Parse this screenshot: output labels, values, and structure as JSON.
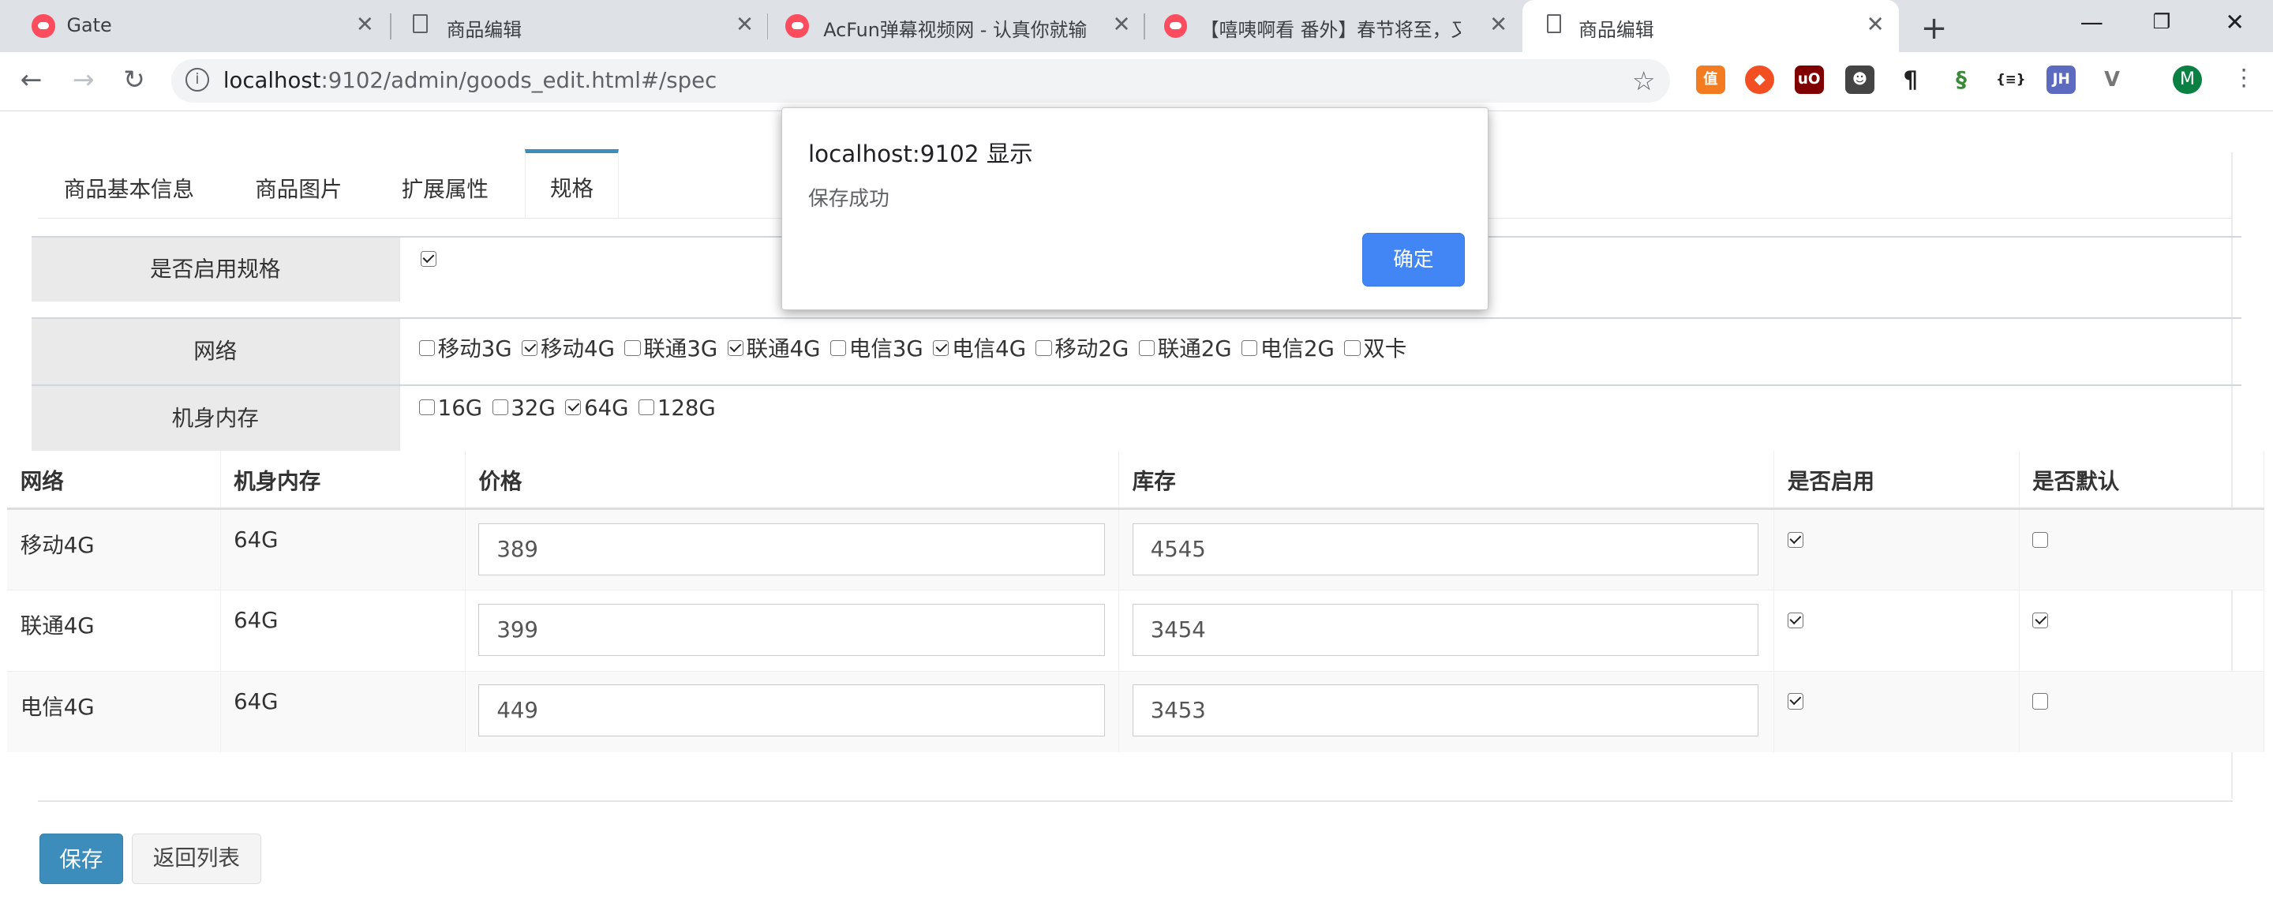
{
  "browser": {
    "tabs": [
      {
        "title": "Gate",
        "icon": "acfun-favicon-icon",
        "active": false
      },
      {
        "title": "商品编辑",
        "icon": "document-icon",
        "active": false
      },
      {
        "title": "AcFun弹幕视频网 - 认真你就输啦",
        "icon": "acfun-favicon-icon",
        "active": false
      },
      {
        "title": "【嘻咦啊看 番外】春节将至，又是",
        "icon": "acfun-favicon-icon",
        "active": false
      },
      {
        "title": "商品编辑",
        "icon": "document-icon",
        "active": true
      }
    ],
    "url_host": "localhost",
    "url_path": ":9102/admin/goods_edit.html#/spec",
    "profile_initial": "M",
    "extensions": [
      "值",
      "◆",
      "uO",
      "☻",
      "¶",
      "§",
      "{≡}",
      "JH",
      "V"
    ]
  },
  "page": {
    "tabs": [
      "商品基本信息",
      "商品图片",
      "扩展属性",
      "规格"
    ],
    "active_tab": "规格",
    "enable_spec_label": "是否启用规格",
    "enable_spec_checked": true,
    "spec_groups": [
      {
        "label": "网络",
        "options": [
          {
            "name": "移动3G",
            "checked": false
          },
          {
            "name": "移动4G",
            "checked": true
          },
          {
            "name": "联通3G",
            "checked": false
          },
          {
            "name": "联通4G",
            "checked": true
          },
          {
            "name": "电信3G",
            "checked": false
          },
          {
            "name": "电信4G",
            "checked": true
          },
          {
            "name": "移动2G",
            "checked": false
          },
          {
            "name": "联通2G",
            "checked": false
          },
          {
            "name": "电信2G",
            "checked": false
          },
          {
            "name": "双卡",
            "checked": false
          }
        ]
      },
      {
        "label": "机身内存",
        "options": [
          {
            "name": "16G",
            "checked": false
          },
          {
            "name": "32G",
            "checked": false
          },
          {
            "name": "64G",
            "checked": true
          },
          {
            "name": "128G",
            "checked": false
          }
        ]
      }
    ],
    "sku_table": {
      "headers": [
        "网络",
        "机身内存",
        "价格",
        "库存",
        "是否启用",
        "是否默认"
      ],
      "rows": [
        {
          "network": "移动4G",
          "memory": "64G",
          "price": "389",
          "stock": "4545",
          "enabled": true,
          "is_default": false
        },
        {
          "network": "联通4G",
          "memory": "64G",
          "price": "399",
          "stock": "3454",
          "enabled": true,
          "is_default": true
        },
        {
          "network": "电信4G",
          "memory": "64G",
          "price": "449",
          "stock": "3453",
          "enabled": true,
          "is_default": false
        }
      ]
    },
    "buttons": {
      "save": "保存",
      "back": "返回列表"
    }
  },
  "dialog": {
    "title": "localhost:9102 显示",
    "message": "保存成功",
    "ok": "确定"
  },
  "colors": {
    "primary": "#3c8dbc",
    "dialog_button": "#4285f4",
    "tabbar": "#dee1e6"
  }
}
